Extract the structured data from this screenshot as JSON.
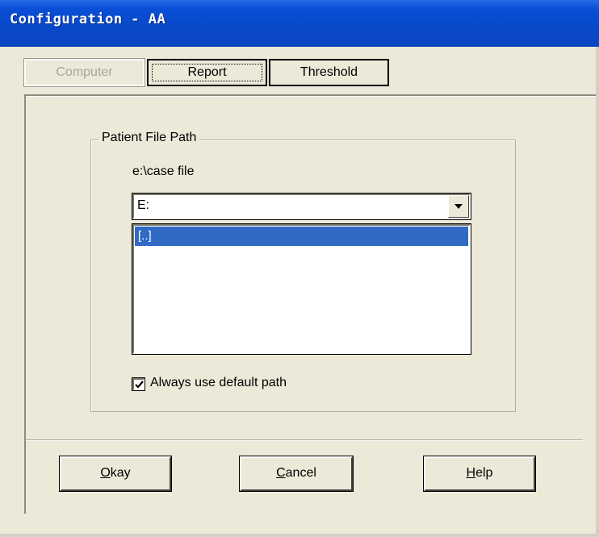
{
  "window": {
    "title": "Configuration - AA"
  },
  "tabs": [
    {
      "label": "Computer",
      "state": "disabled"
    },
    {
      "label": "Report",
      "state": "focused"
    },
    {
      "label": "Threshold",
      "state": "normal"
    }
  ],
  "group": {
    "label": "Patient File Path",
    "current_path": "e:\\case file",
    "drive_combo": {
      "value": "E:",
      "arrow_icon": "chevron-down-icon"
    },
    "directory_list": {
      "items": [
        "[..]"
      ],
      "selected_index": 0
    },
    "default_path_checkbox": {
      "label": "Always use default path",
      "checked": true
    }
  },
  "buttons": {
    "okay": {
      "mnemonic": "O",
      "rest": "kay"
    },
    "cancel": {
      "mnemonic": "C",
      "rest": "ancel"
    },
    "help": {
      "mnemonic": "H",
      "rest": "elp"
    }
  },
  "colors": {
    "title_bar": "#0a4fd6",
    "selection": "#316ac5",
    "face": "#ece9d8",
    "disabled_text": "#a7a596"
  }
}
